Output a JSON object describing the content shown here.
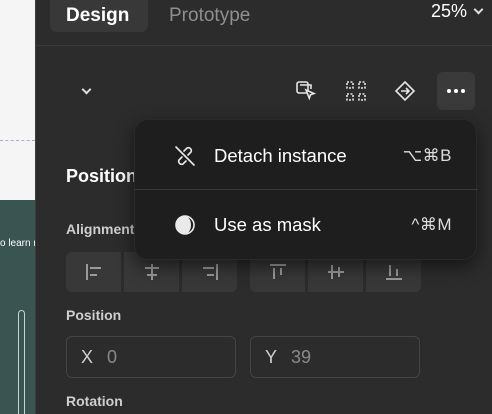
{
  "canvas": {
    "frame_text": "o learn r"
  },
  "tabs": {
    "design": "Design",
    "prototype": "Prototype"
  },
  "zoom": {
    "value": "25%"
  },
  "toolbar": {
    "icons": [
      "selection-icon",
      "component-icon",
      "instance-icon",
      "more-icon"
    ]
  },
  "menu": {
    "items": [
      {
        "label": "Detach instance",
        "shortcut": "⌥⌘B",
        "icon": "detach-icon"
      },
      {
        "label": "Use as mask",
        "shortcut": "^⌘M",
        "icon": "mask-icon"
      }
    ]
  },
  "sections": {
    "position_title": "Position",
    "alignment_label": "Alignment",
    "position_label": "Position",
    "rotation_label": "Rotation"
  },
  "fields": {
    "x": {
      "label": "X",
      "value": "0"
    },
    "y": {
      "label": "Y",
      "value": "39"
    }
  }
}
